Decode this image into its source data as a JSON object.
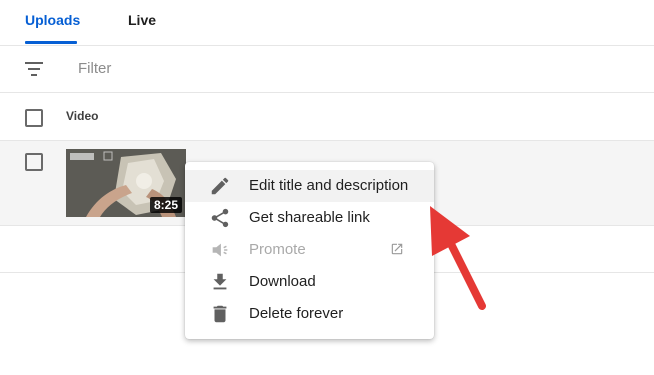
{
  "tabs": [
    {
      "label": "Uploads",
      "active": true
    },
    {
      "label": "Live",
      "active": false
    }
  ],
  "filter": {
    "placeholder": "Filter",
    "icon": "filter-icon"
  },
  "table": {
    "header": {
      "video_label": "Video"
    },
    "rows": [
      {
        "duration": "8:25"
      }
    ]
  },
  "context_menu": {
    "items": [
      {
        "label": "Edit title and description",
        "icon": "pencil-icon",
        "highlighted": true,
        "disabled": false
      },
      {
        "label": "Get shareable link",
        "icon": "share-icon",
        "highlighted": false,
        "disabled": false
      },
      {
        "label": "Promote",
        "icon": "megaphone-icon",
        "highlighted": false,
        "disabled": true,
        "trailing_icon": "external-link-icon"
      },
      {
        "label": "Download",
        "icon": "download-icon",
        "highlighted": false,
        "disabled": false
      },
      {
        "label": "Delete forever",
        "icon": "trash-icon",
        "highlighted": false,
        "disabled": false
      }
    ]
  },
  "colors": {
    "accent": "#065fd4",
    "annotation_arrow": "#e53935",
    "menu_highlight": "#f2f2f2"
  }
}
